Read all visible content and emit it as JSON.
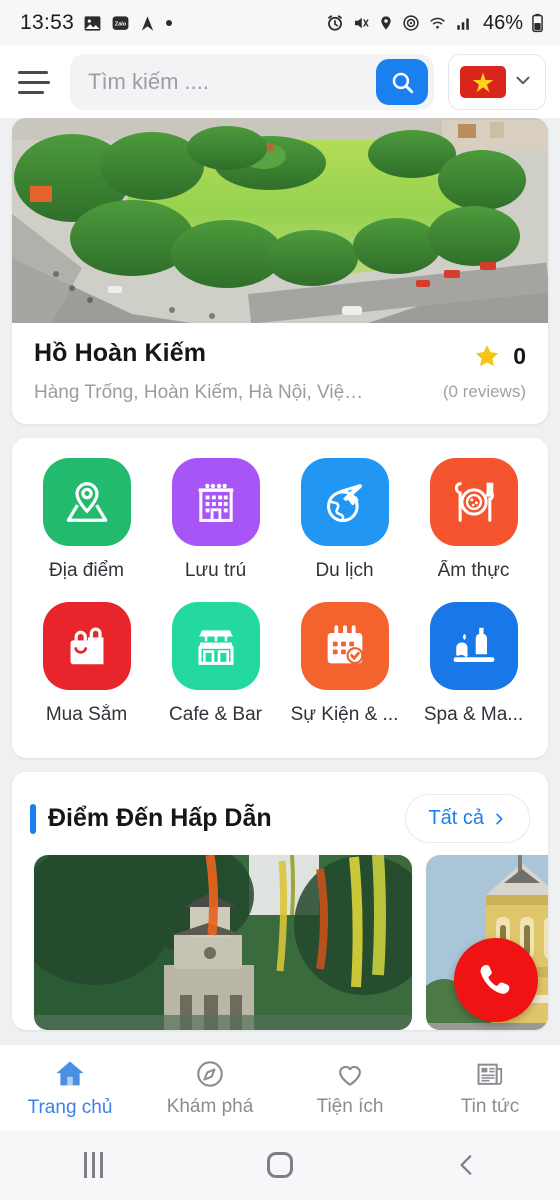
{
  "statusbar": {
    "time": "13:53",
    "battery_text": "46%",
    "left_icons": [
      "photo-icon",
      "zalo-icon",
      "navigation-arrow-icon",
      "dot-icon"
    ],
    "right_icons": [
      "alarm-icon",
      "mute-icon",
      "location-icon",
      "hotspot-icon",
      "wifi-icon",
      "signal-icon",
      "battery-icon"
    ]
  },
  "header": {
    "menu_icon": "hamburger-menu-icon",
    "search_placeholder": "Tìm kiếm ....",
    "search_value": "",
    "search_icon": "search-icon",
    "language": {
      "flag": "vietnam-flag",
      "flag_color": "#da251d",
      "star_color": "#ffd21e",
      "chevron_icon": "chevron-down-icon"
    }
  },
  "place_card": {
    "image_alt": "hoan-kiem-lake-aerial-photo",
    "name": "Hồ Hoàn Kiếm",
    "address": "Hàng Trống, Hoàn Kiếm, Hà Nội, Việ…",
    "rating": "0",
    "reviews": "(0 reviews)",
    "star_icon": "star-icon",
    "star_color": "#f5c518"
  },
  "categories": [
    {
      "label": "Địa điểm",
      "icon": "map-pin-icon",
      "color": "#22bb6e"
    },
    {
      "label": "Lưu trú",
      "icon": "hotel-building-icon",
      "color": "#a855f7"
    },
    {
      "label": "Du lịch",
      "icon": "globe-airplane-icon",
      "color": "#2196f3"
    },
    {
      "label": "Ẩm thực",
      "icon": "food-plate-icon",
      "color": "#f4552e"
    },
    {
      "label": "Mua Sắm",
      "icon": "shopping-bag-icon",
      "color": "#e8252a"
    },
    {
      "label": "Cafe & Bar",
      "icon": "cafe-bar-icon",
      "color": "#23d9a0"
    },
    {
      "label": "Sự Kiện & ...",
      "icon": "calendar-check-icon",
      "color": "#f4622e"
    },
    {
      "label": "Spa & Ma...",
      "icon": "spa-massage-icon",
      "color": "#1878e8"
    }
  ],
  "destinations_section": {
    "title": "Điểm Đến Hấp Dẫn",
    "accent_color": "#1a7fef",
    "all_label": "Tất cả",
    "all_chevron": "chevron-right-icon",
    "cards": [
      {
        "alt": "turtle-tower-hoan-kiem-photo"
      },
      {
        "alt": "hanoi-opera-house-photo"
      }
    ]
  },
  "fab": {
    "icon": "phone-call-icon",
    "color": "#f11313"
  },
  "bottom_nav": [
    {
      "label": "Trang chủ",
      "icon": "home-icon",
      "active": true
    },
    {
      "label": "Khám phá",
      "icon": "compass-icon",
      "active": false
    },
    {
      "label": "Tiện ích",
      "icon": "heart-icon",
      "active": false
    },
    {
      "label": "Tin tức",
      "icon": "news-icon",
      "active": false
    }
  ],
  "system_nav": {
    "recents_icon": "recents-icon",
    "home_icon": "home-square-icon",
    "back_icon": "back-chevron-icon"
  }
}
